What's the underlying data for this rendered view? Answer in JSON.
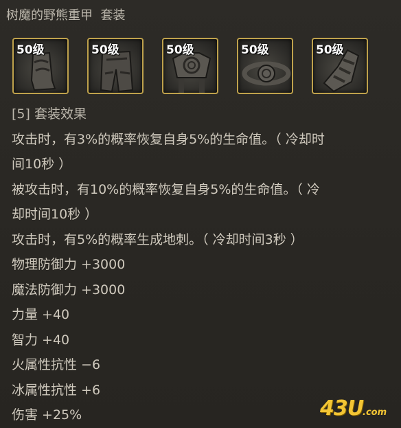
{
  "title": "树魔的野熊重甲  套装",
  "items": [
    {
      "level": "50级",
      "icon": "boots-icon"
    },
    {
      "level": "50级",
      "icon": "leggings-icon"
    },
    {
      "level": "50级",
      "icon": "chestplate-icon"
    },
    {
      "level": "50级",
      "icon": "belt-icon"
    },
    {
      "level": "50级",
      "icon": "gauntlet-icon"
    }
  ],
  "set": {
    "header": "[5] 套装效果",
    "lines": [
      "攻击时，有3%的概率恢复自身5%的生命值。（ 冷却时",
      "间10秒 ）",
      "被攻击时，有10%的概率恢复自身5%的生命值。（ 冷",
      "却时间10秒 ）",
      "攻击时，有5%的概率生成地刺。（ 冷却时间3秒 ）",
      "物理防御力 +3000",
      "魔法防御力 +3000",
      "力量 +40",
      "智力 +40",
      "火属性抗性 −6",
      "冰属性抗性 +6",
      "伤害 +25%"
    ]
  },
  "watermark": {
    "number": "43U",
    "suffix": ".com"
  },
  "colors": {
    "frame": "#bfa24c",
    "text": "#cfc9bd",
    "logo": "#f3c534"
  }
}
